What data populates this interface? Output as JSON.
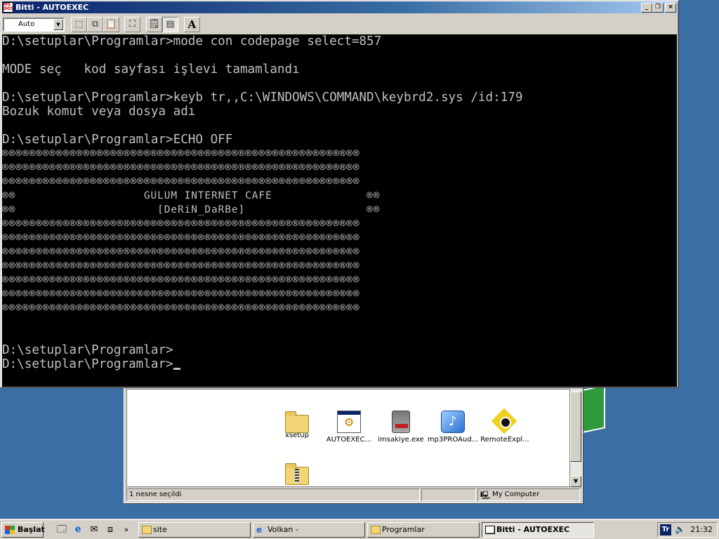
{
  "dos_window": {
    "title": "Bitti - AUTOEXEC",
    "icon_text": "MS DOS",
    "font_select": "Auto",
    "colors": {
      "console_bg": "#000000",
      "console_fg": "#c0c0c0",
      "titlebar": "#0a246a"
    },
    "console_lines": [
      "D:\\setuplar\\Programlar>mode con codepage select=857",
      "",
      "MODE seç   kod sayfası işlevi tamamlandı",
      "",
      "D:\\setuplar\\Programlar>keyb tr,,C:\\WINDOWS\\COMMAND\\keybrd2.sys /id:179",
      "Bozuk komut veya dosya adı",
      "",
      "D:\\setuplar\\Programlar>ECHO OFF",
      "®®®®®®®®®®®®®®®®®®®®®®®®®®®®®®®®®®®®®®®®®®®®®®®®®®®®®",
      "®®®®®®®®®®®®®®®®®®®®®®®®®®®®®®®®®®®®®®®®®®®®®®®®®®®®®",
      "®®®®®®®®®®®®®®®®®®®®®®®®®®®®®®®®®®®®®®®®®®®®®®®®®®®®®",
      "®®                   GULUM INTERNET CAFE              ®®",
      "®®                     [DeRiN_DaRBe]                  ®®",
      "®®®®®®®®®®®®®®®®®®®®®®®®®®®®®®®®®®®®®®®®®®®®®®®®®®®®®",
      "®®®®®®®®®®®®®®®®®®®®®®®®®®®®®®®®®®®®®®®®®®®®®®®®®®®®®",
      "®®®®®®®®®®®®®®®®®®®®®®®®®®®®®®®®®®®®®®®®®®®®®®®®®®®®®",
      "®®®®®®®®®®®®®®®®®®®®®®®®®®®®®®®®®®®®®®®®®®®®®®®®®®®®®",
      "®®®®®®®®®®®®®®®®®®®®®®®®®®®®®®®®®®®®®®®®®®®®®®®®®®®®®",
      "®®®®®®®®®®®®®®®®®®®®®®®®®®®®®®®®®®®®®®®®®®®®®®®®®®®®®",
      "®®®®®®®®®®®®®®®®®®®®®®®®®®®®®®®®®®®®®®®®®®®®®®®®®®®®®",
      "",
      "",
      "D:\\setuplar\\Programlar>",
      "D:\\setuplar\\Programlar>"
    ]
  },
  "explorer": {
    "files": [
      {
        "label": "xsetup",
        "icon": "folder-icon"
      },
      {
        "label": "AUTOEXEC...",
        "icon": "batch-file-icon"
      },
      {
        "label": "imsakiye.exe",
        "icon": "setup-exe-icon"
      },
      {
        "label": "mp3PROAud...",
        "icon": "mp3pro-icon"
      },
      {
        "label": "RemoteExpl...",
        "icon": "remote-explorer-icon"
      },
      {
        "label": "",
        "icon": "zip-folder-icon"
      }
    ],
    "status_selected": "1 nesne seçildi",
    "status_location": "My Computer"
  },
  "taskbar": {
    "start_label": "Başlat",
    "tasks": [
      {
        "label": "site",
        "icon": "folder-icon"
      },
      {
        "label": "Volkan -",
        "icon": "ie-icon"
      },
      {
        "label": "Programlar",
        "icon": "folder-icon"
      },
      {
        "label": "Bitti - AUTOEXEC",
        "icon": "msdos-icon",
        "active": true
      }
    ],
    "lang": "Tr",
    "clock": "21:32"
  }
}
